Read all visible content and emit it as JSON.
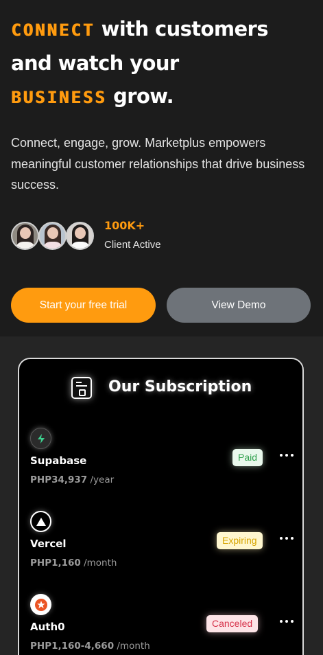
{
  "hero": {
    "headline": {
      "pixel_word_1": "CONNECT",
      "text_1": " with customers",
      "text_2": "and watch your",
      "pixel_word_2": "BUSINESS",
      "text_3": " grow."
    },
    "description": "Connect, engage, grow. Marketplus empowers meaningful customer relationships that drive business success.",
    "stat": {
      "value": "100K+",
      "label": "Client Active"
    },
    "primary_cta": "Start your free trial",
    "secondary_cta": "View Demo"
  },
  "subscription": {
    "title": "Our Subscription",
    "items": [
      {
        "name": "Supabase",
        "price": "PHP34,937",
        "period": " /year",
        "status": "Paid",
        "logo": "supabase-bolt-icon"
      },
      {
        "name": "Vercel",
        "price": "PHP1,160",
        "period": " /month",
        "status": "Expiring",
        "logo": "vercel-triangle-icon"
      },
      {
        "name": "Auth0",
        "price": "PHP1,160-4,660",
        "period": " /month",
        "status": "Canceled",
        "logo": "auth0-star-icon"
      }
    ]
  },
  "colors": {
    "accent": "#ff9b0f",
    "background": "#1c1c1c",
    "card": "#000000",
    "paid": "#2e9f4b",
    "expiring": "#d6a400",
    "canceled": "#d6324a"
  }
}
